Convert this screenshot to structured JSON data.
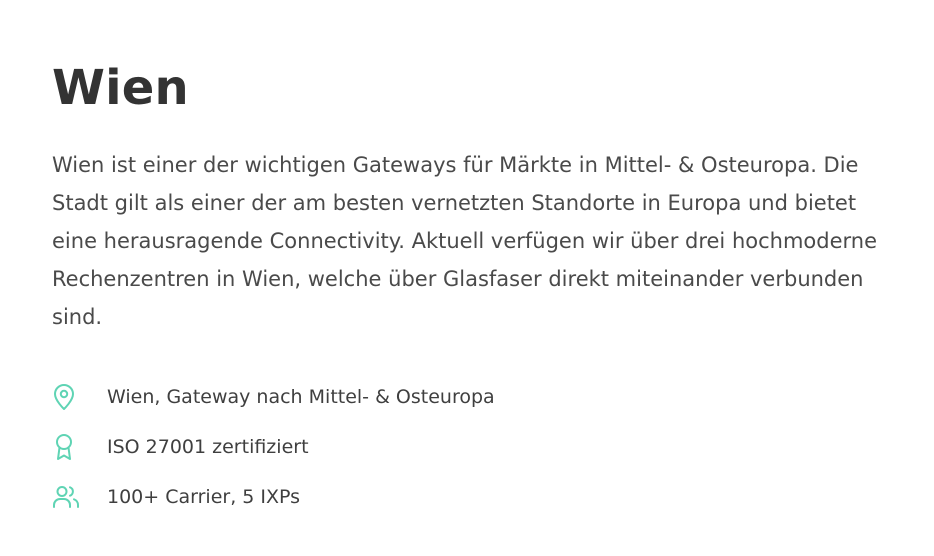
{
  "page": {
    "title": "Wien",
    "description": "Wien ist einer der wichtigen Gateways für Märkte in Mittel- & Osteuropa. Die Stadt gilt als einer der am besten vernetzten Standorte in Europa und bietet eine herausragende Connectivity. Aktuell verfügen wir über drei hochmoderne Rechenzentren in Wien, welche über Glasfaser direkt miteinander verbunden sind."
  },
  "features": [
    {
      "icon": "location-pin-icon",
      "text": "Wien, Gateway nach Mittel- & Osteuropa"
    },
    {
      "icon": "award-badge-icon",
      "text": "ISO 27001 zertifiziert"
    },
    {
      "icon": "users-icon",
      "text": "100+ Carrier, 5 IXPs"
    }
  ],
  "colors": {
    "icon_accent": "#5fd4b4",
    "text": "#3f3f3f",
    "title": "#333333",
    "background": "#ffffff"
  }
}
